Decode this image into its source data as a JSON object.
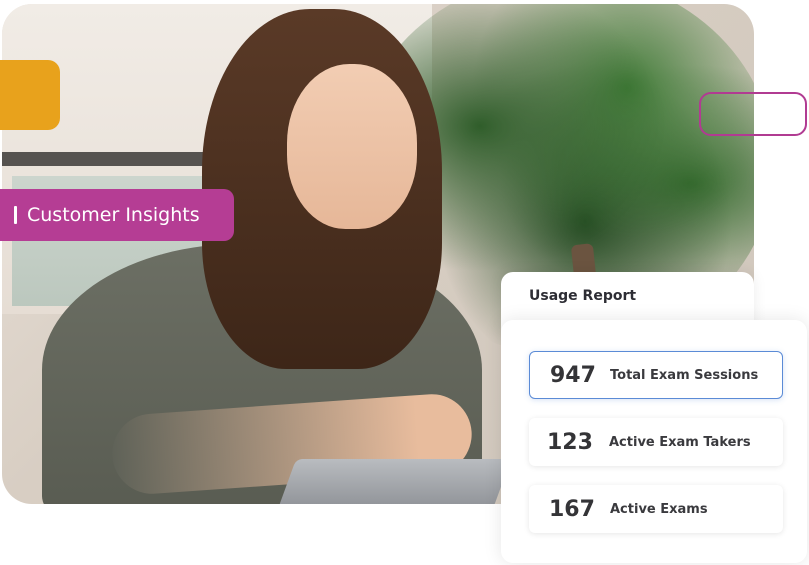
{
  "insights": {
    "label": "Customer Insights"
  },
  "report": {
    "title": "Usage Report",
    "stats": [
      {
        "value": "947",
        "label": "Total Exam Sessions",
        "selected": true
      },
      {
        "value": "123",
        "label": "Active Exam Takers",
        "selected": false
      },
      {
        "value": "167",
        "label": "Active Exams",
        "selected": false
      }
    ]
  },
  "colors": {
    "accent_magenta": "#b53d94",
    "accent_orange": "#e8a21c",
    "selected_border": "#5b8bd6"
  }
}
